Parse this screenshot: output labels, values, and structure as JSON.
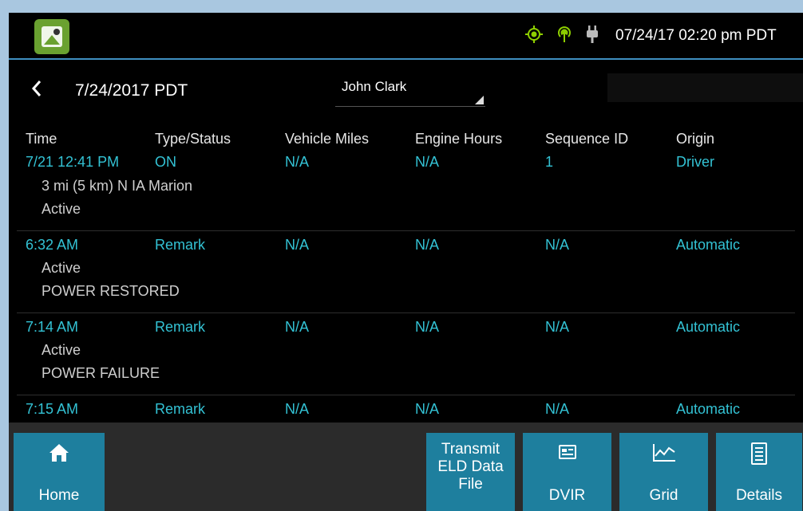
{
  "status_bar": {
    "datetime": "07/24/17 02:20 pm PDT",
    "icons": [
      "app-icon",
      "gps-icon",
      "signal-icon",
      "power-plug-icon"
    ]
  },
  "header": {
    "date": "7/24/2017 PDT",
    "driver": "John Clark"
  },
  "table": {
    "columns": [
      "Time",
      "Type/Status",
      "Vehicle Miles",
      "Engine Hours",
      "Sequence ID",
      "Origin"
    ],
    "rows": [
      {
        "time": "7/21 12:41 PM",
        "type": "ON",
        "miles": "N/A",
        "hours": "N/A",
        "seq": "1",
        "origin": "Driver",
        "details": [
          "3 mi (5 km) N IA Marion",
          "Active"
        ]
      },
      {
        "time": "6:32 AM",
        "type": "Remark",
        "miles": "N/A",
        "hours": "N/A",
        "seq": "N/A",
        "origin": "Automatic",
        "details": [
          "Active",
          "POWER RESTORED"
        ]
      },
      {
        "time": "7:14 AM",
        "type": "Remark",
        "miles": "N/A",
        "hours": "N/A",
        "seq": "N/A",
        "origin": "Automatic",
        "details": [
          "Active",
          "POWER FAILURE"
        ]
      },
      {
        "time": "7:15 AM",
        "type": "Remark",
        "miles": "N/A",
        "hours": "N/A",
        "seq": "N/A",
        "origin": "Automatic",
        "details": []
      }
    ]
  },
  "toolbar": {
    "home": "Home",
    "transmit": [
      "Transmit",
      "ELD Data",
      "File"
    ],
    "dvir": "DVIR",
    "grid": "Grid",
    "details": "Details"
  },
  "colors": {
    "accent": "#33c2d4",
    "button": "#1e7f9e",
    "brand_icon": "#6aa130"
  }
}
